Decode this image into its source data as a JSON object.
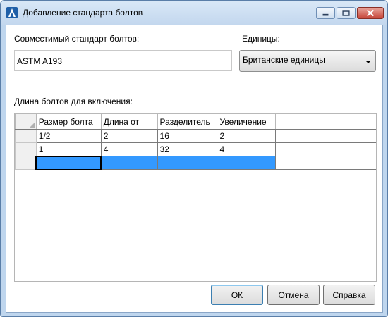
{
  "window": {
    "title": "Добавление стандарта болтов",
    "icon": "autodesk-a-logo-icon",
    "controls": [
      "minimize-icon",
      "maximize-icon",
      "close-icon"
    ]
  },
  "standard": {
    "label": "Совместимый стандарт болтов:",
    "value": "ASTM A193"
  },
  "units": {
    "label": "Единицы:",
    "selected": "Британские единицы"
  },
  "grid": {
    "label": "Длина болтов для включения:",
    "columns": [
      "Размер болта",
      "Длина от",
      "Разделитель",
      "Увеличение"
    ],
    "rows": [
      [
        "1/2",
        "2",
        "16",
        "2"
      ],
      [
        "1",
        "4",
        "32",
        "4"
      ]
    ],
    "new_row": [
      "",
      "",
      "",
      ""
    ]
  },
  "buttons": {
    "ok": "ОК",
    "cancel": "Отмена",
    "help": "Справка"
  },
  "colors": {
    "selection": "#3399ff",
    "title_bar": "#c3d7ee",
    "close_button": "#c7463a"
  }
}
